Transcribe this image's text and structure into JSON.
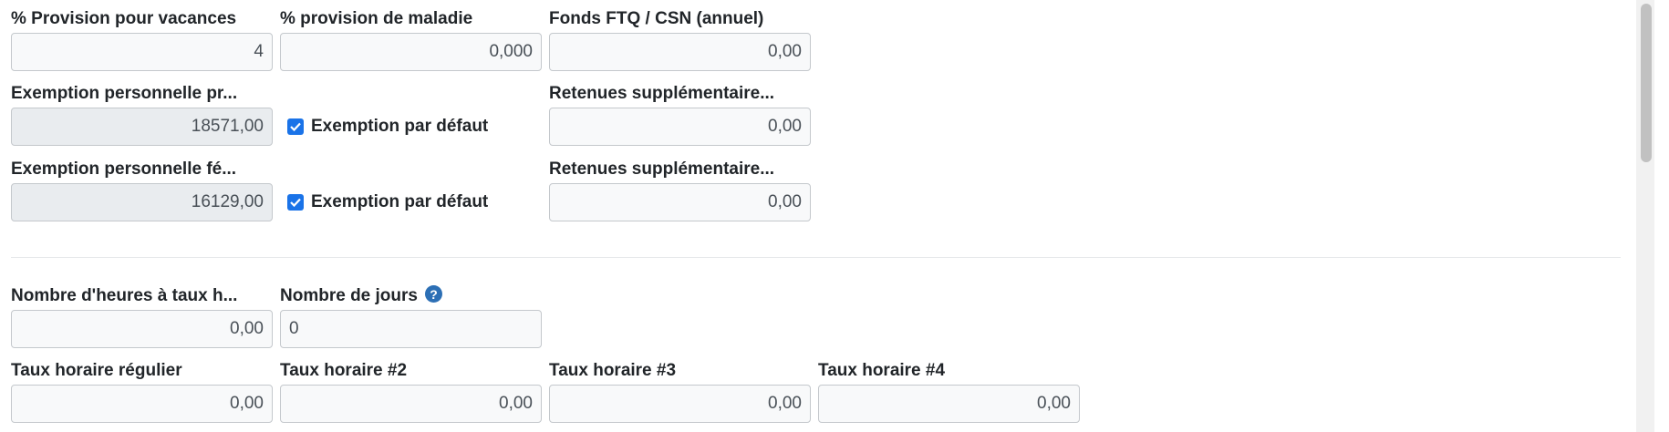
{
  "row1": {
    "vacation_label": "% Provision pour vacances",
    "vacation_value": "4",
    "sick_label": "% provision de maladie",
    "sick_value": "0,000",
    "ftq_label": "Fonds FTQ / CSN (annuel)",
    "ftq_value": "0,00"
  },
  "row2": {
    "exemption_label": "Exemption personnelle pr...",
    "exemption_value": "18571,00",
    "default_label": "Exemption par défaut",
    "default_checked": true,
    "extra_label": "Retenues supplémentaire...",
    "extra_value": "0,00"
  },
  "row3": {
    "exemption_label": "Exemption personnelle fé...",
    "exemption_value": "16129,00",
    "default_label": "Exemption par défaut",
    "default_checked": true,
    "extra_label": "Retenues supplémentaire...",
    "extra_value": "0,00"
  },
  "row4": {
    "hours_label": "Nombre d'heures à taux h...",
    "hours_value": "0,00",
    "days_label": "Nombre de jours",
    "days_value": "0",
    "help_icon": "question-circle-icon"
  },
  "row5": {
    "regular_label": "Taux horaire régulier",
    "regular_value": "0,00",
    "rate2_label": "Taux horaire #2",
    "rate2_value": "0,00",
    "rate3_label": "Taux horaire #3",
    "rate3_value": "0,00",
    "rate4_label": "Taux horaire #4",
    "rate4_value": "0,00"
  },
  "colors": {
    "checkbox": "#1a73e8",
    "help_icon": "#2c6fb5",
    "readonly_bg": "#e9ecef"
  }
}
